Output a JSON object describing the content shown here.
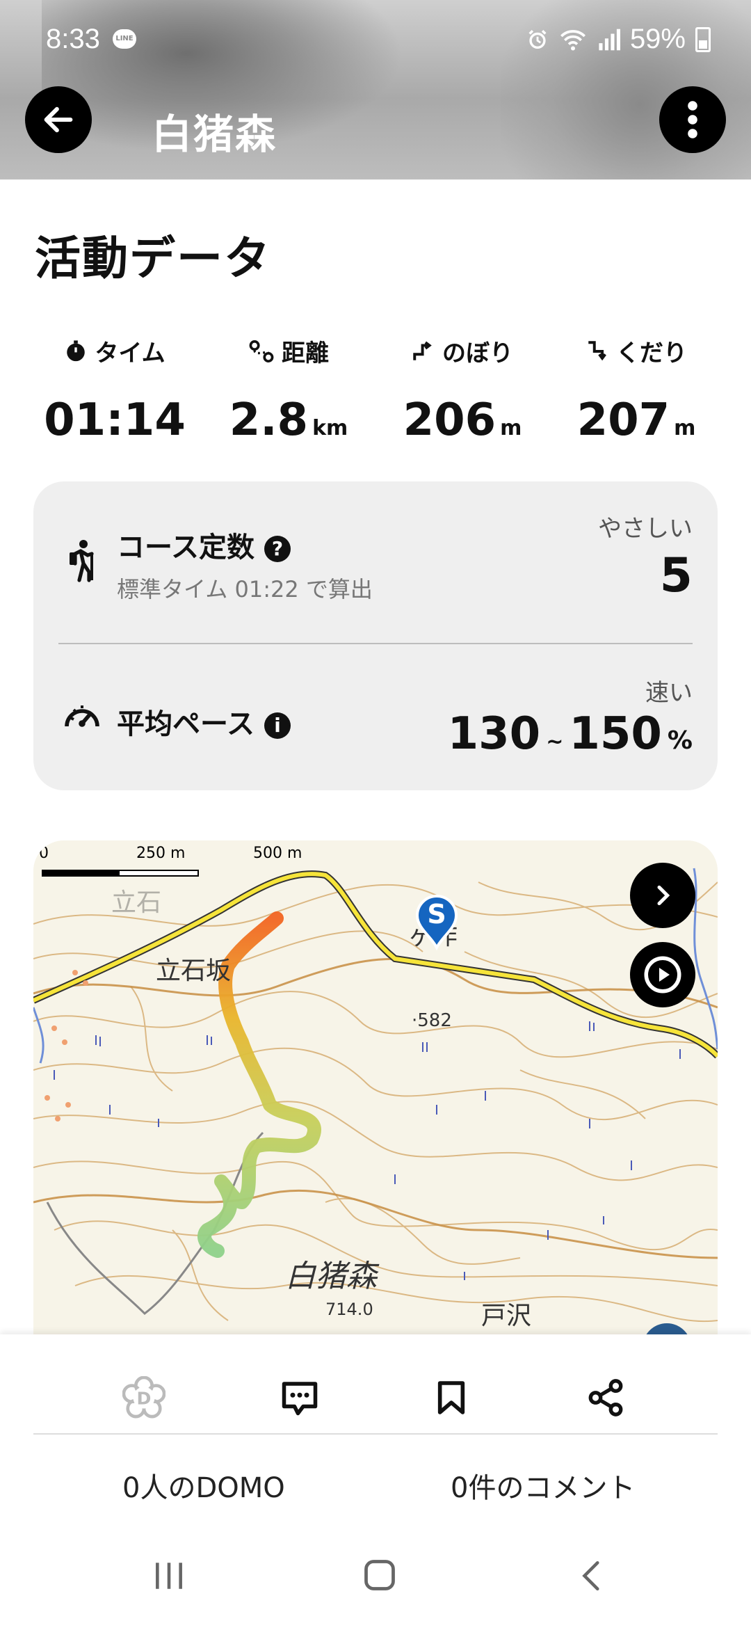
{
  "status": {
    "time": "8:33",
    "battery": "59%"
  },
  "header": {
    "title": "白猪森"
  },
  "section_title": "活動データ",
  "stats": [
    {
      "label": "タイム",
      "value": "01:14",
      "unit": "",
      "icon": "stopwatch-icon"
    },
    {
      "label": "距離",
      "value": "2.8",
      "unit": "km",
      "icon": "route-icon"
    },
    {
      "label": "のぼり",
      "value": "206",
      "unit": "m",
      "icon": "ascent-icon"
    },
    {
      "label": "くだり",
      "value": "207",
      "unit": "m",
      "icon": "descent-icon"
    }
  ],
  "course": {
    "label": "コース定数",
    "sub": "標準タイム 01:22 で算出",
    "difficulty": "やさしい",
    "value": "5"
  },
  "pace": {
    "label": "平均ペース",
    "speed": "速い",
    "min": "130",
    "sep": "~",
    "max": "150",
    "unit": "%"
  },
  "map": {
    "scale": [
      "0",
      "250 m",
      "500 m"
    ],
    "places": [
      "立石坂",
      "ヶ作",
      "·582",
      "白猪森",
      "714.0",
      "戸沢",
      "立石"
    ],
    "start_marker": "S"
  },
  "bottom": {
    "domo_count": "0人のDOMO",
    "comment_count": "0件のコメント"
  },
  "colors": {
    "accent_start": "#1565c0",
    "track_start": "#f26522",
    "track_end": "#8fd18a"
  }
}
